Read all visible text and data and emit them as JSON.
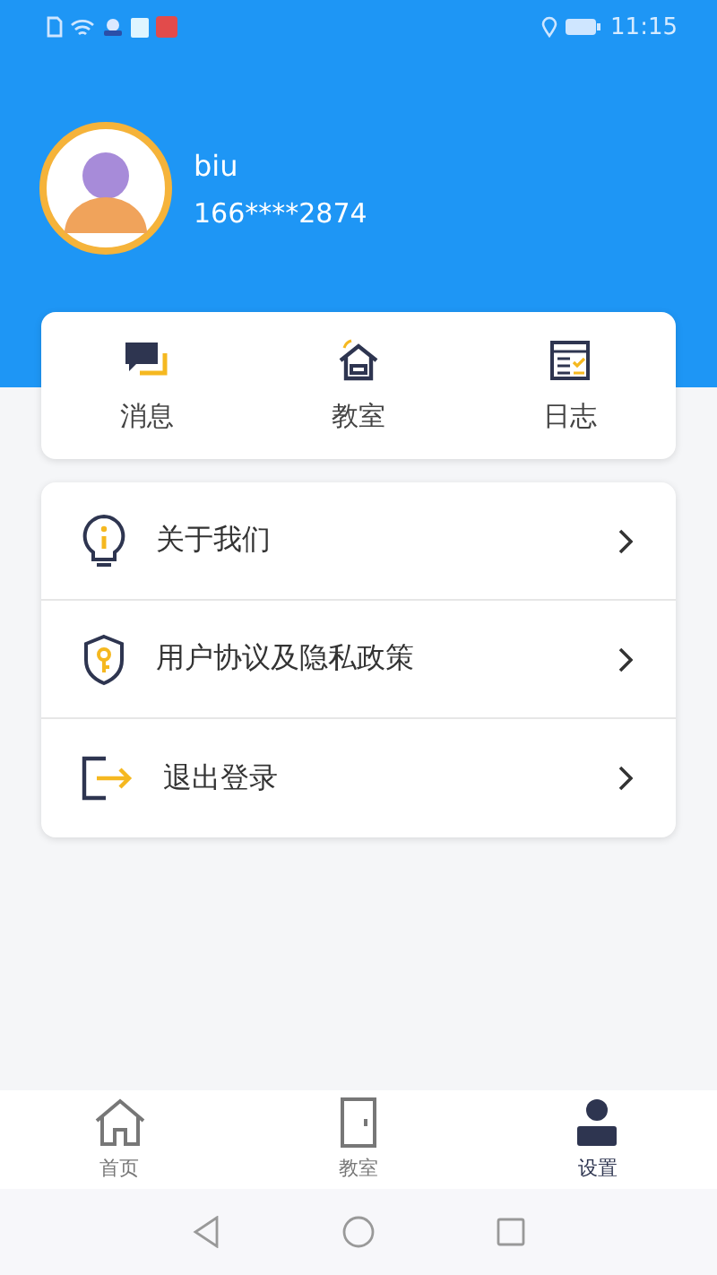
{
  "status_bar": {
    "time": "11:15"
  },
  "profile": {
    "name": "biu",
    "phone": "166****2874"
  },
  "shortcuts": [
    {
      "kind": "message",
      "label": "消息"
    },
    {
      "kind": "classroom",
      "label": "教室"
    },
    {
      "kind": "log",
      "label": "日志"
    }
  ],
  "menu": [
    {
      "kind": "about",
      "label": "关于我们"
    },
    {
      "kind": "privacy",
      "label": "用户协议及隐私政策"
    },
    {
      "kind": "logout",
      "label": "退出登录"
    }
  ],
  "tab_bar": [
    {
      "kind": "home",
      "label": "首页",
      "selected": false
    },
    {
      "kind": "door",
      "label": "教室",
      "selected": false
    },
    {
      "kind": "person",
      "label": "设置",
      "selected": true
    }
  ]
}
